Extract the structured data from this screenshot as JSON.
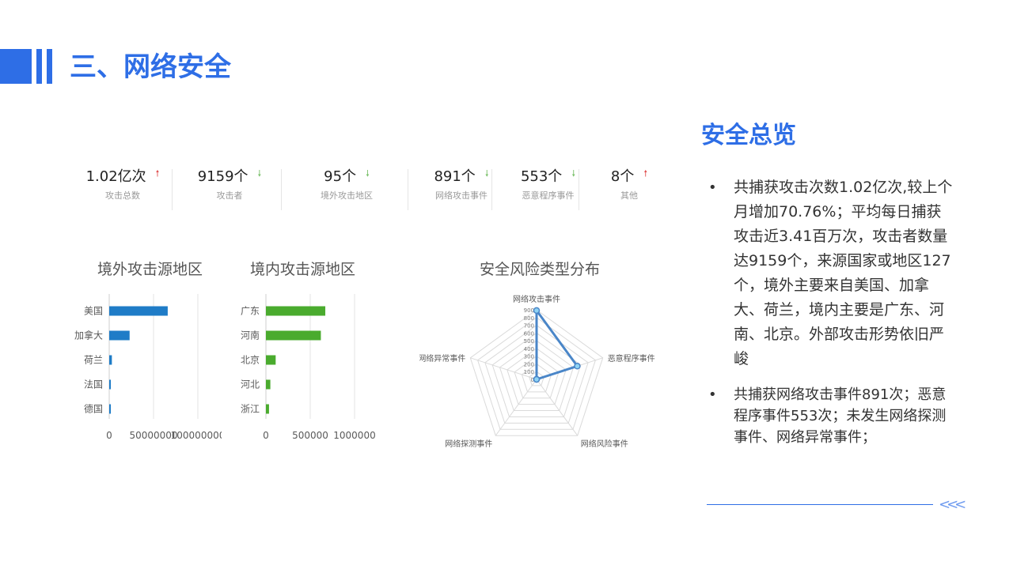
{
  "page": {
    "title": "三、网络安全"
  },
  "kpis": [
    {
      "value": "1.02亿次",
      "label": "攻击总数",
      "trend": "up",
      "arrow": "🠕"
    },
    {
      "value": "9159个",
      "label": "攻击者",
      "trend": "down",
      "arrow": "🠗"
    },
    {
      "value": "95个",
      "label": "境外攻击地区",
      "trend": "down",
      "arrow": "🠗"
    },
    {
      "value": "891个",
      "label": "网络攻击事件",
      "trend": "down",
      "arrow": "🠗"
    },
    {
      "value": "553个",
      "label": "恶意程序事件",
      "trend": "down",
      "arrow": "🠗"
    },
    {
      "value": "8个",
      "label": "其他",
      "trend": "up",
      "arrow": "🠕"
    }
  ],
  "colors": {
    "accent": "#2e6ee6",
    "up": "#e05050",
    "down": "#7ac06a",
    "bar_blue": "#1f7cc7",
    "bar_green": "#4aab2e",
    "radar": "#4a86c8"
  },
  "chart_data": [
    {
      "type": "bar",
      "orientation": "horizontal",
      "title": "境外攻击源地区",
      "categories": [
        "美国",
        "加拿大",
        "荷兰",
        "法国",
        "德国"
      ],
      "values": [
        66000000,
        23000000,
        3000000,
        1500000,
        1000000
      ],
      "xlim": [
        0,
        100000000
      ],
      "xticks": [
        "0",
        "50000000",
        "100000000"
      ],
      "grid": true
    },
    {
      "type": "bar",
      "orientation": "horizontal",
      "title": "境内攻击源地区",
      "categories": [
        "广东",
        "河南",
        "北京",
        "河北",
        "浙江"
      ],
      "values": [
        670000,
        620000,
        110000,
        50000,
        35000
      ],
      "xlim": [
        0,
        1000000
      ],
      "xticks": [
        "0",
        "500000",
        "1000000"
      ],
      "grid": true
    },
    {
      "type": "radar",
      "title": "安全风险类型分布",
      "axes": [
        "网络攻击事件",
        "恶意程序事件",
        "网络风险事件",
        "网络探测事件",
        "网络异常事件"
      ],
      "values": [
        891,
        553,
        0,
        0,
        0
      ],
      "rlim": [
        0,
        900
      ],
      "rticks": [
        "0",
        "100",
        "200",
        "300",
        "400",
        "500",
        "600",
        "700",
        "800",
        "900"
      ]
    }
  ],
  "overview": {
    "title": "安全总览",
    "bullets": [
      "共捕获攻击次数1.02亿次,较上个月增加70.76%；平均每日捕获攻击近3.41百万次，攻击者数量达9159个，来源国家或地区127个，境外主要来自美国、加拿大、荷兰，境内主要是广东、河南、北京。外部攻击形势依旧严峻",
      "共捕获网络攻击事件891次；恶意程序事件553次；未发生网络探测事件、网络异常事件；"
    ]
  },
  "footer": {
    "chevrons": "<<<"
  }
}
